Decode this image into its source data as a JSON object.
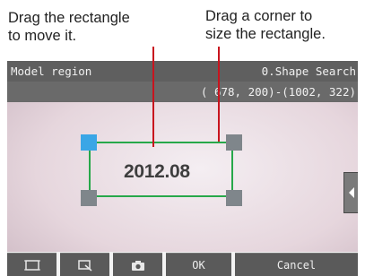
{
  "callouts": {
    "move": {
      "line1": "Drag the rectangle",
      "line2": "to move it."
    },
    "size": {
      "line1": "Drag a corner to",
      "line2": "size the rectangle."
    }
  },
  "header": {
    "left": "Model region",
    "right": "0.Shape Search",
    "coords": "( 678, 200)-(1002, 322)"
  },
  "canvas": {
    "center_text": "2012.08"
  },
  "toolbar": {
    "ok_label": "OK",
    "cancel_label": "Cancel"
  },
  "icons": {
    "tb1": "region-frame-icon",
    "tb2": "zoom-region-icon",
    "tb3": "camera-icon",
    "side": "chevron-left-icon"
  },
  "colors": {
    "roi_stroke": "#27a84a",
    "handle": "#7f868b",
    "handle_selected": "#3aa6e6",
    "callout_line": "#c8141e"
  }
}
